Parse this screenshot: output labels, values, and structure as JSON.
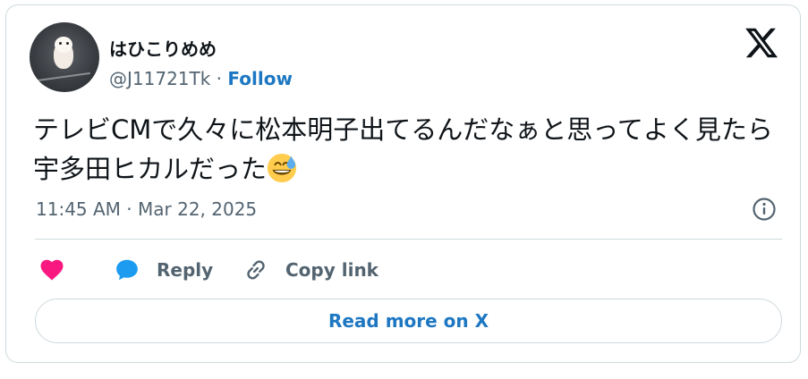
{
  "author": {
    "display_name": "はひこりめめ",
    "handle": "@J11721Tk",
    "separator": " · ",
    "follow_label": "Follow"
  },
  "tweet": {
    "text": "テレビCMで久々に松本明子出てるんだなぁと思ってよく見たら宇多田ヒカルだった",
    "emoji": "grinning-face-with-sweat",
    "timestamp": "11:45 AM · Mar 22, 2025"
  },
  "actions": {
    "like_icon": "heart-icon",
    "reply_label": "Reply",
    "copy_link_label": "Copy link"
  },
  "read_more_label": "Read more on X",
  "colors": {
    "link_blue": "#1d77c2",
    "like_pink": "#f91880",
    "reply_blue": "#1d9bf0",
    "text_primary": "#0f1419",
    "text_secondary": "#536471",
    "border": "#cfd9de"
  }
}
